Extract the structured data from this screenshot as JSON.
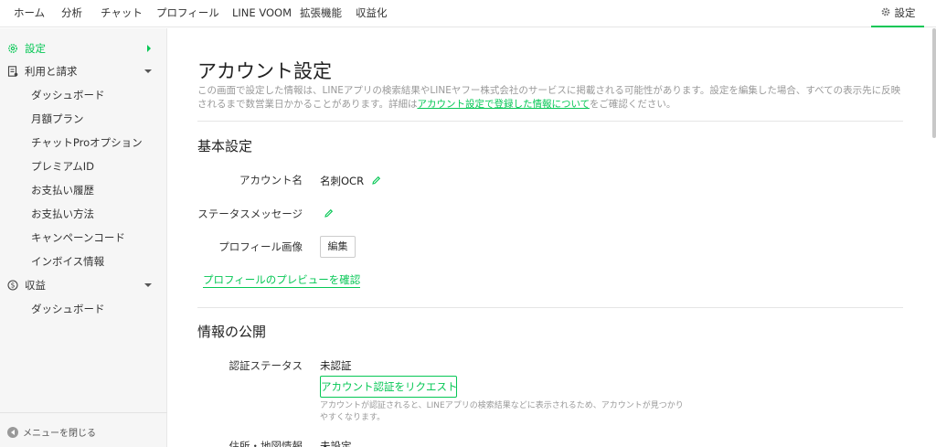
{
  "topnav": {
    "tabs": [
      "ホーム",
      "分析",
      "チャット",
      "プロフィール",
      "LINE VOOM",
      "拡張機能",
      "収益化"
    ],
    "settings_label": "設定"
  },
  "sidebar": {
    "settings": "設定",
    "billing": "利用と請求",
    "billing_items": [
      "ダッシュボード",
      "月額プラン",
      "チャットProオプション",
      "プレミアムID",
      "お支払い履歴",
      "お支払い方法",
      "キャンペーンコード",
      "インボイス情報"
    ],
    "revenue": "収益",
    "revenue_items": [
      "ダッシュボード"
    ],
    "close_menu": "メニューを閉じる"
  },
  "main": {
    "title": "アカウント設定",
    "desc_before": "この画面で設定した情報は、LINEアプリの検索結果やLINEヤフー株式会社のサービスに掲載される可能性があります。設定を編集した場合、すべての表示先に反映されるまで数営業日かかることがあります。詳細は",
    "desc_link": "アカウント設定で登録した情報について",
    "desc_after": "をご確認ください。",
    "basic": {
      "title": "基本設定",
      "account_name_label": "アカウント名",
      "account_name_value": "名刺OCR",
      "status_label": "ステータスメッセージ",
      "profile_image_label": "プロフィール画像",
      "edit_button": "編集",
      "preview_link": "プロフィールのプレビューを確認"
    },
    "publish": {
      "title": "情報の公開",
      "verify_label": "認証ステータス",
      "verify_value": "未認証",
      "request_button": "アカウント認証をリクエスト",
      "note": "アカウントが認証されると、LINEアプリの検索結果などに表示されるため、アカウントが見つかりやすくなります。",
      "address_label": "住所・地図情報",
      "address_value": "未設定"
    }
  },
  "colors": {
    "accent": "#06c755"
  }
}
